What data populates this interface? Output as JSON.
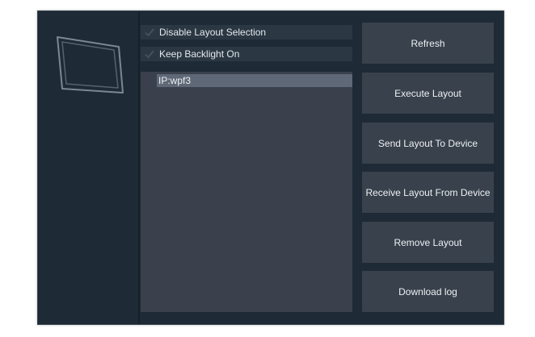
{
  "options": {
    "disable_layout_selection": {
      "label": "Disable Layout Selection",
      "checked": false
    },
    "keep_backlight_on": {
      "label": "Keep Backlight On",
      "checked": false
    }
  },
  "device_list": {
    "items": [
      "IP:wpf3"
    ],
    "selected_index": 0
  },
  "buttons": {
    "refresh": "Refresh",
    "execute_layout": "Execute Layout",
    "send_layout": "Send Layout To Device",
    "receive_layout": "Receive Layout From Device",
    "remove_layout": "Remove Layout",
    "download_log": "Download log"
  },
  "icons": {
    "device": "tablet-icon",
    "checkbox": "checkmark-icon"
  },
  "colors": {
    "window_background": "#1e2a35",
    "button_background": "#38414c",
    "list_background": "#3a414d",
    "selected_item": "#5e6876",
    "text": "#eef1f4"
  }
}
